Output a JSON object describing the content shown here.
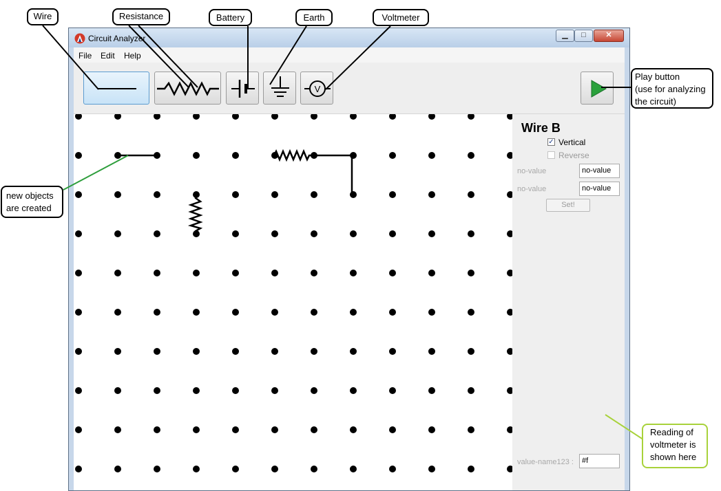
{
  "window": {
    "title": "Circuit Analyzer",
    "controls": {
      "minimize": "▁",
      "maximize": "□",
      "close": "✕"
    }
  },
  "menu": {
    "items": [
      "File",
      "Edit",
      "Help"
    ]
  },
  "toolbar": {
    "tools": [
      {
        "name": "wire",
        "icon": "wire-icon",
        "selected": true
      },
      {
        "name": "resistance",
        "icon": "resistor-icon",
        "selected": false
      },
      {
        "name": "battery",
        "icon": "battery-icon",
        "selected": false
      },
      {
        "name": "earth",
        "icon": "ground-icon",
        "selected": false
      },
      {
        "name": "voltmeter",
        "icon": "voltmeter-icon",
        "selected": false,
        "symbol": "V"
      }
    ],
    "play": {
      "icon": "play-icon",
      "color": "#2aa13c"
    }
  },
  "side_panel": {
    "title": "Wire B",
    "vertical": {
      "label": "Vertical",
      "checked": true,
      "mark": "✓"
    },
    "reverse": {
      "label": "Reverse",
      "checked": false,
      "disabled": true
    },
    "fields": [
      {
        "label": "no-value",
        "value": "no-value"
      },
      {
        "label": "no-value",
        "value": "no-value"
      }
    ],
    "set_button": "Set!",
    "voltmeter_reading": {
      "label": "value-name123 :",
      "value": "#f"
    }
  },
  "callouts": {
    "wire": "Wire",
    "resistance": "Resistance",
    "battery": "Battery",
    "earth": "Earth",
    "voltmeter": "Voltmeter",
    "play": "Play button\n(use for analyzing\nthe circuit)",
    "new_objects": "new objects\nare created",
    "voltmeter_reading": "Reading of\nvoltmeter is\nshown here"
  },
  "colors": {
    "selected_tool": "#c8e3f7",
    "play_green": "#2aa13c",
    "reading_callout_border": "#a8d23a",
    "leader_green": "#2e9e3c"
  }
}
